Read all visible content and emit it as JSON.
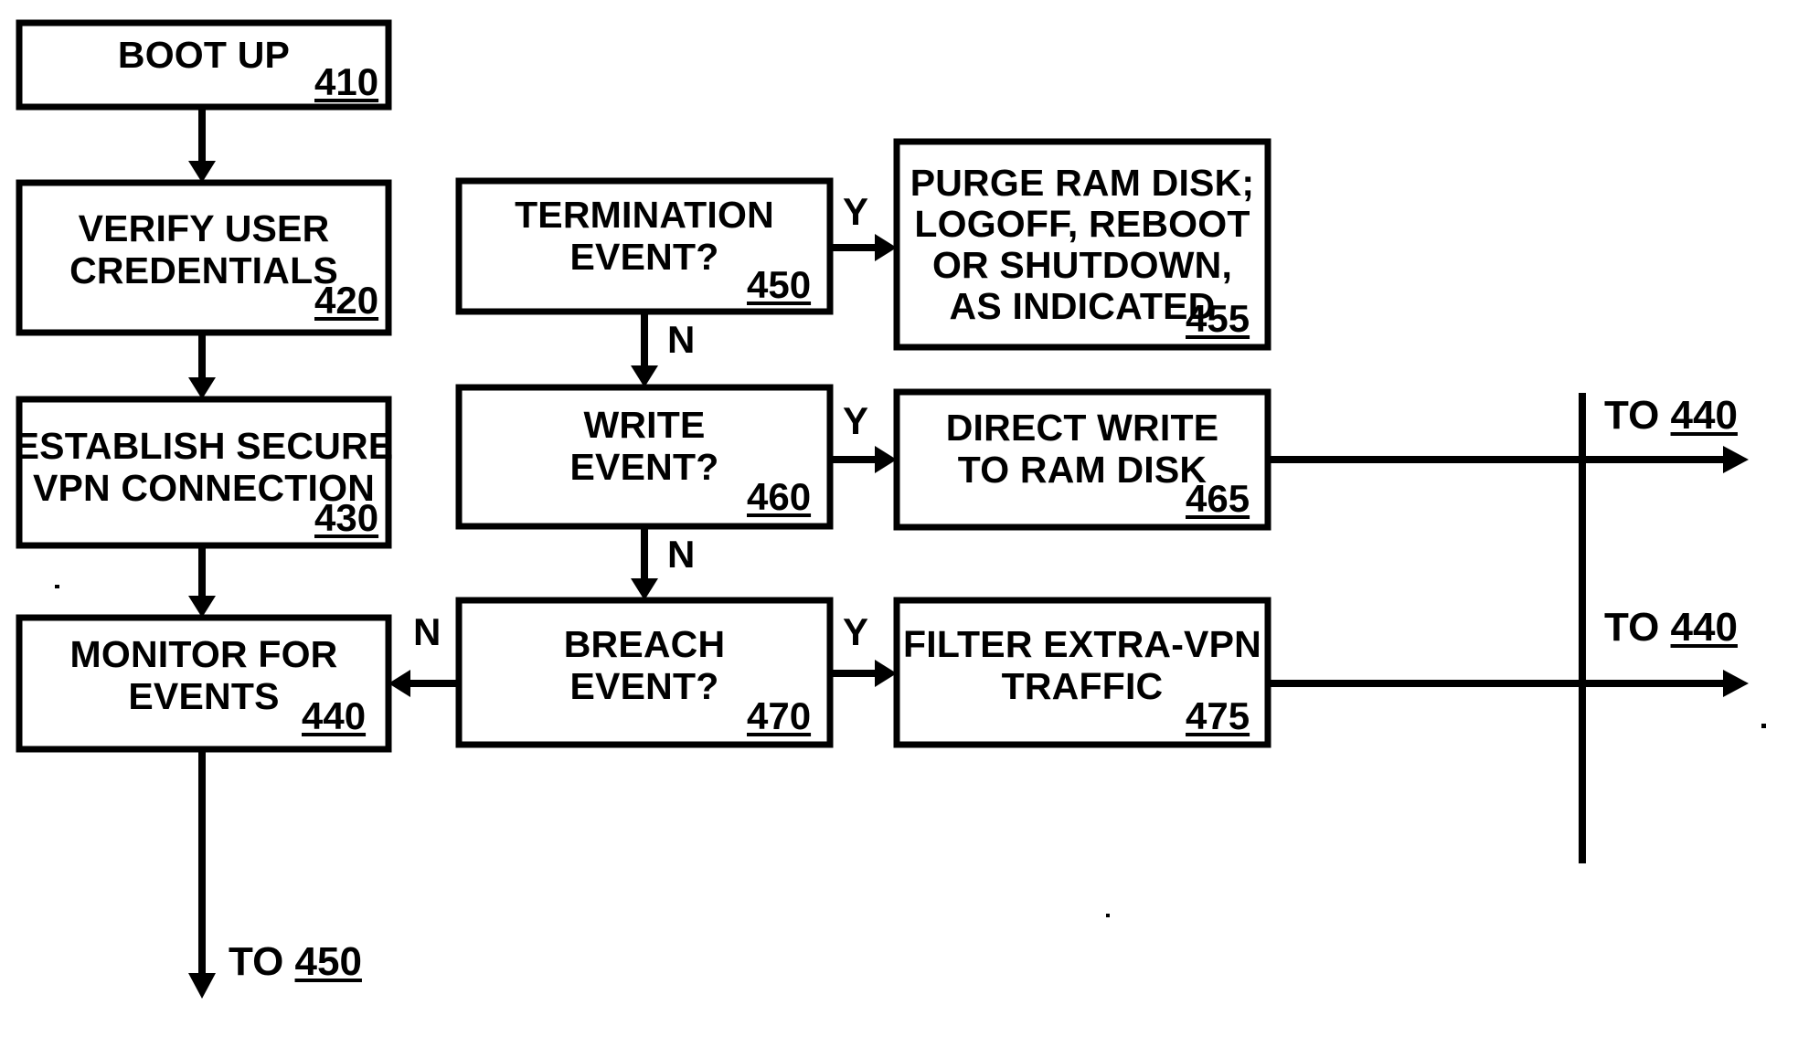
{
  "figure": {
    "type": "flowchart",
    "title": "",
    "orientation": "two-column process flow with yes/no decision branches"
  },
  "nodes": [
    {
      "id": "boot_up",
      "label": "BOOT UP",
      "ref": "410",
      "shape": "rectangle",
      "column": "left"
    },
    {
      "id": "verify_user_credentials",
      "label": "VERIFY USER\nCREDENTIALS",
      "ref": "420",
      "shape": "rectangle",
      "column": "left"
    },
    {
      "id": "establish_secure_vpn",
      "label": "ESTABLISH SECURE\nVPN CONNECTION",
      "ref": "430",
      "shape": "rectangle",
      "column": "left"
    },
    {
      "id": "monitor_for_events",
      "label": "MONITOR FOR\nEVENTS",
      "ref": "440",
      "shape": "rectangle",
      "column": "left"
    },
    {
      "id": "termination_event",
      "label": "TERMINATION\nEVENT?",
      "ref": "450",
      "shape": "rectangle-decision",
      "column": "middle"
    },
    {
      "id": "purge_ram_disk",
      "label": "PURGE RAM DISK;\nLOGOFF, REBOOT\nOR SHUTDOWN,\nAS INDICATED",
      "ref": "455",
      "shape": "rectangle",
      "column": "right"
    },
    {
      "id": "write_event",
      "label": "WRITE\nEVENT?",
      "ref": "460",
      "shape": "rectangle-decision",
      "column": "middle"
    },
    {
      "id": "direct_write_ram_disk",
      "label": "DIRECT WRITE\nTO RAM DISK",
      "ref": "465",
      "shape": "rectangle",
      "column": "right"
    },
    {
      "id": "breach_event",
      "label": "BREACH\nEVENT?",
      "ref": "470",
      "shape": "rectangle-decision",
      "column": "middle"
    },
    {
      "id": "filter_extra_vpn",
      "label": "FILTER EXTRA-VPN\nTRAFFIC",
      "ref": "475",
      "shape": "rectangle",
      "column": "right"
    }
  ],
  "edges": [
    {
      "from": "boot_up",
      "to": "verify_user_credentials",
      "label": ""
    },
    {
      "from": "verify_user_credentials",
      "to": "establish_secure_vpn",
      "label": ""
    },
    {
      "from": "establish_secure_vpn",
      "to": "monitor_for_events",
      "label": ""
    },
    {
      "from": "termination_event",
      "to": "purge_ram_disk",
      "label": "Y"
    },
    {
      "from": "termination_event",
      "to": "write_event",
      "label": "N"
    },
    {
      "from": "write_event",
      "to": "direct_write_ram_disk",
      "label": "Y"
    },
    {
      "from": "write_event",
      "to": "breach_event",
      "label": "N"
    },
    {
      "from": "breach_event",
      "to": "filter_extra_vpn",
      "label": "Y"
    },
    {
      "from": "breach_event",
      "to": "monitor_for_events",
      "label": "N"
    }
  ],
  "edge_labels": {
    "termination_yes": "Y",
    "termination_no": "N",
    "write_yes": "Y",
    "write_no": "N",
    "breach_yes": "Y",
    "breach_no": "N"
  },
  "offpage_connectors": [
    {
      "id": "goto_440_from_465",
      "prefix": "TO ",
      "ref": "440"
    },
    {
      "id": "goto_440_from_475",
      "prefix": "TO ",
      "ref": "440"
    },
    {
      "id": "goto_450_from_440",
      "prefix": "TO ",
      "ref": "450"
    }
  ],
  "style": {
    "stroke_color": "#000000",
    "fill_color": "#ffffff",
    "text_color": "#000000",
    "background": "#ffffff"
  }
}
